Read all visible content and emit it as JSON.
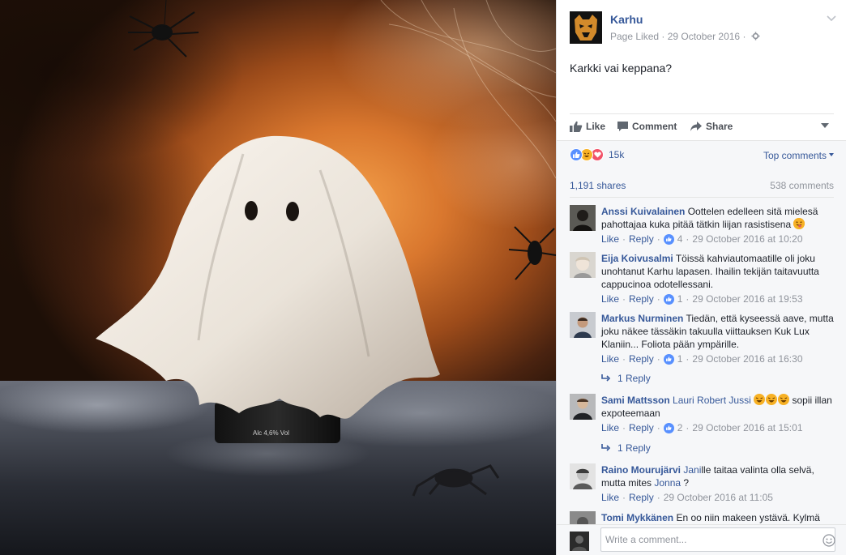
{
  "post": {
    "page_name": "Karhu",
    "meta": "Page Liked · 29 October 2016 ·",
    "text": "Karkki vai keppana?",
    "photo_label": "Alc 4,6% Vol"
  },
  "actions": {
    "like": "Like",
    "comment": "Comment",
    "share": "Share"
  },
  "stats": {
    "reactions_count": "15k",
    "sort_label": "Top comments",
    "shares": "1,191 shares",
    "comments": "538 comments"
  },
  "comments": [
    {
      "author": "Anssi Kuivalainen",
      "text": "Oottelen edelleen sitä mielesä pahottajaa kuka pitää tätkin liijan rasistisena",
      "like": "Like",
      "reply": "Reply",
      "likes": "4",
      "time": "29 October 2016 at 10:20"
    },
    {
      "author": "Eija Koivusalmi",
      "text": "Töissä kahviautomaatille oli joku unohtanut Karhu lapasen. Ihailin tekijän taitavuutta cappucinoa odotellessani.",
      "like": "Like",
      "reply": "Reply",
      "likes": "1",
      "time": "29 October 2016 at 19:53"
    },
    {
      "author": "Markus Nurminen",
      "text": "Tiedän, että kyseessä aave, mutta joku näkee tässäkin takuulla viittauksen Kuk Lux Klaniin... Foliota pään ympärille.",
      "like": "Like",
      "reply": "Reply",
      "likes": "1",
      "time": "29 October 2016 at 16:30",
      "replies": "1 Reply"
    },
    {
      "author": "Sami Mattsson",
      "tag": "Lauri Robert Jussi",
      "text": "sopii illan expoteemaan",
      "like": "Like",
      "reply": "Reply",
      "likes": "2",
      "time": "29 October 2016 at 15:01",
      "replies": "1 Reply"
    },
    {
      "author": "Raino Mourujärvi",
      "tag": "Jani",
      "text_a": "lle taitaa valinta olla selvä, mutta mites",
      "tag2": "Jonna",
      "text_b": "?",
      "like": "Like",
      "reply": "Reply",
      "time": "29 October 2016 at 11:05"
    },
    {
      "author": "Tomi Mykkänen",
      "text": "En oo niin makeen ystävä. Kylmä"
    }
  ],
  "composer": {
    "placeholder": "Write a comment..."
  }
}
